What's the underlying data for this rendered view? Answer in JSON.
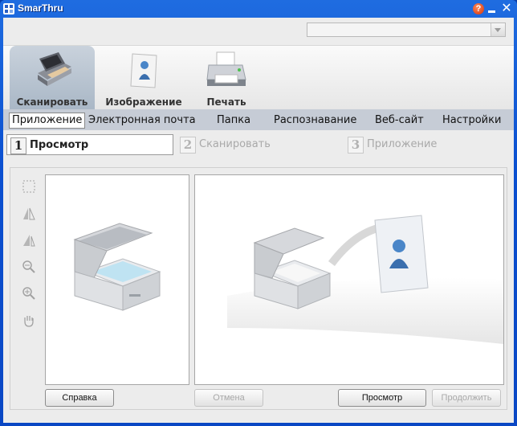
{
  "window": {
    "title": "SmarThru"
  },
  "main_tabs": [
    {
      "label": "Сканировать",
      "icon": "scanner-icon",
      "active": true
    },
    {
      "label": "Изображение",
      "icon": "image-icon",
      "active": false
    },
    {
      "label": "Печать",
      "icon": "printer-icon",
      "active": false
    }
  ],
  "sub_nav": [
    {
      "label": "Приложение",
      "active": true
    },
    {
      "label": "Электронная почта",
      "active": false
    },
    {
      "label": "Папка",
      "active": false
    },
    {
      "label": "Распознавание",
      "active": false
    },
    {
      "label": "Веб-сайт",
      "active": false
    },
    {
      "label": "Настройки",
      "active": false
    }
  ],
  "steps": [
    {
      "num": "1",
      "label": "Просмотр",
      "state": "active"
    },
    {
      "num": "2",
      "label": "Сканировать",
      "state": "disabled"
    },
    {
      "num": "3",
      "label": "Приложение",
      "state": "disabled"
    }
  ],
  "toolbar_icons": [
    "select-area-icon",
    "flip-horizontal-icon",
    "flip-vertical-icon",
    "zoom-out-icon",
    "zoom-in-icon",
    "hand-pan-icon"
  ],
  "buttons": {
    "help": "Справка",
    "cancel": "Отмена",
    "preview": "Просмотр",
    "continue": "Продолжить"
  },
  "colors": {
    "title_bar": "#0a4fd0",
    "subnav_bg": "#c6ccd6",
    "active_tab": "#b3c0cd"
  }
}
